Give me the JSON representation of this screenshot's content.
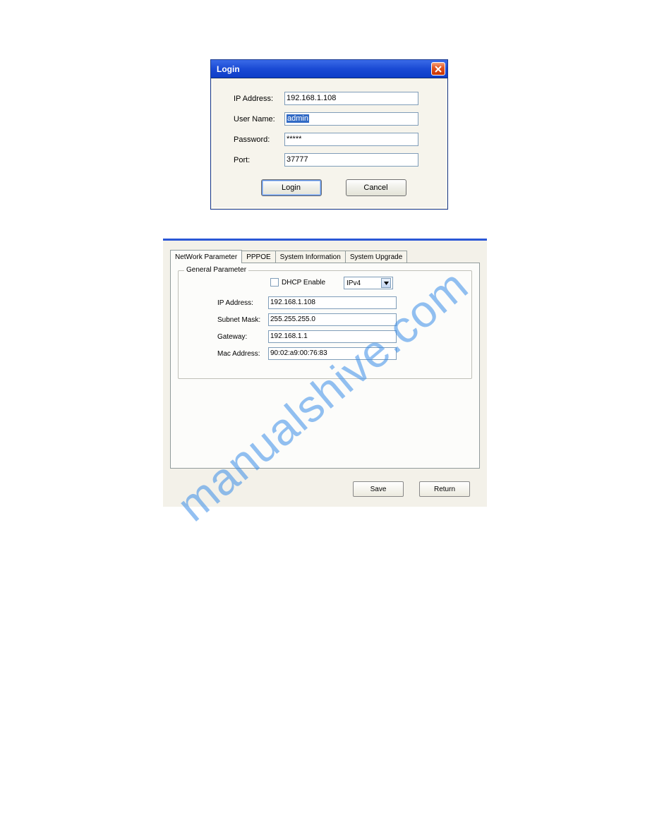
{
  "login": {
    "title": "Login",
    "labels": {
      "ip": "IP Address:",
      "user": "User Name:",
      "pass": "Password:",
      "port": "Port:"
    },
    "values": {
      "ip": "192.168.1.108",
      "user": "admin",
      "pass": "*****",
      "port": "37777"
    },
    "buttons": {
      "login": "Login",
      "cancel": "Cancel"
    }
  },
  "settings": {
    "tabs": [
      "NetWork Parameter",
      "PPPOE",
      "System Information",
      "System Upgrade"
    ],
    "groupbox_title": "General Parameter",
    "dhcp_label": "DHCP Enable",
    "ip_version": "IPv4",
    "labels": {
      "ip": "IP Address:",
      "subnet": "Subnet Mask:",
      "gateway": "Gateway:",
      "mac": "Mac Address:"
    },
    "values": {
      "ip": "192.168.1.108",
      "subnet": "255.255.255.0",
      "gateway": "192.168.1.1",
      "mac": "90:02:a9:00:76:83"
    },
    "buttons": {
      "save": "Save",
      "return": "Return"
    }
  },
  "watermark": "manualshive.com"
}
